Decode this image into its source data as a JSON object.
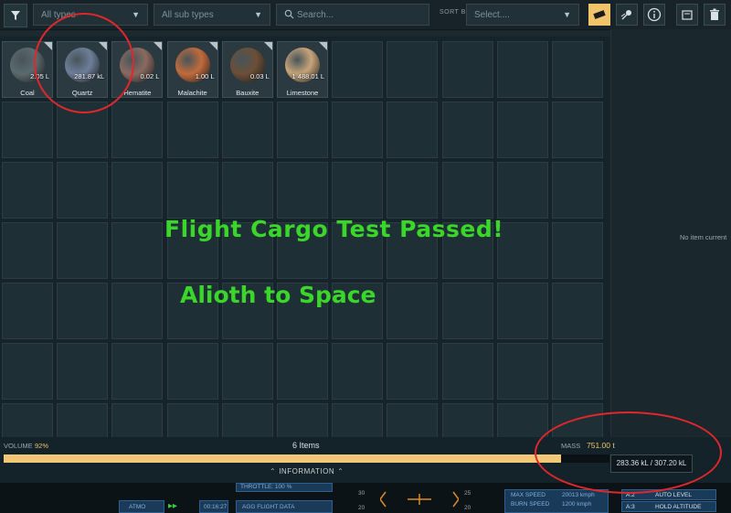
{
  "toolbar": {
    "type_filter": "All types",
    "subtype_filter": "All sub types",
    "search_placeholder": "Search...",
    "sort_by_label": "SORT BY",
    "sort_select": "Select....",
    "icons": [
      "filter-icon",
      "cargo-icon",
      "asteroid-icon",
      "info-icon",
      "recycle-icon",
      "trash-icon"
    ]
  },
  "items": [
    {
      "name": "Coal",
      "qty": "2.05 L",
      "color": "#5b6a6e"
    },
    {
      "name": "Quartz",
      "qty": "281.87 kL",
      "color": "#6d7f99"
    },
    {
      "name": "Hematite",
      "qty": "0.02 L",
      "color": "#8a6a60"
    },
    {
      "name": "Malachite",
      "qty": "1.00 L",
      "color": "#c16b3c"
    },
    {
      "name": "Bauxite",
      "qty": "0.03 L",
      "color": "#6b4f38"
    },
    {
      "name": "Limestone",
      "qty": "1 488.01 L",
      "color": "#c7a47a"
    }
  ],
  "side_panel": {
    "empty_text": "No item current"
  },
  "overlay": {
    "line1": "Flight Cargo Test Passed!",
    "line2": "Alioth to Space"
  },
  "footer": {
    "volume_label": "VOLUME",
    "volume_pct": "92%",
    "volume_fraction": 0.92,
    "items_count": "6 Items",
    "mass_label": "MASS",
    "mass_value": "751.00 t",
    "capacity_tooltip": "283.36 kL / 307.20 kL",
    "information_label": "INFORMATION"
  },
  "hud": {
    "atmo": "ATMO",
    "time": "00:16:27",
    "throttle": "THROTTLE: 100 %",
    "agg": "AGG FLIGHT DATA",
    "ticks": [
      "30",
      "25",
      "20",
      "20"
    ],
    "max_speed_label": "MAX SPEED",
    "max_speed_value": "20013 kmph",
    "burn_speed_label": "BURN SPEED",
    "burn_speed_value": "1200 kmph",
    "a2": "A:2",
    "a2_label": "AUTO LEVEL",
    "a3": "A:3",
    "a3_label": "HOLD ALTITUDE"
  }
}
